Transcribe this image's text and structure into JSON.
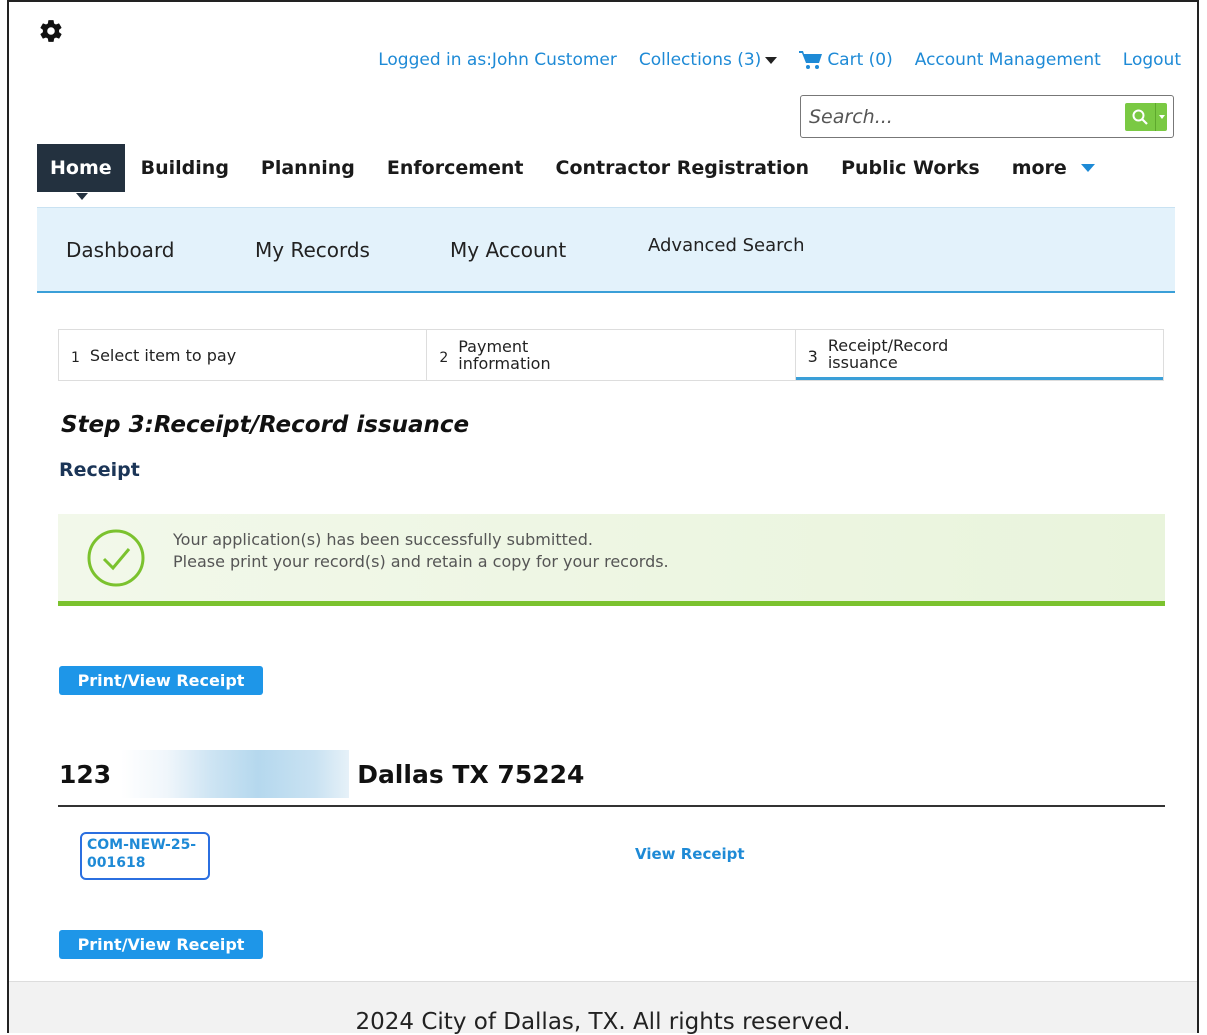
{
  "header": {
    "logged_in": "Logged in as:John Customer",
    "collections": "Collections (3)",
    "cart": "Cart (0)",
    "account_management": "Account Management",
    "logout": "Logout"
  },
  "search": {
    "placeholder": "Search..."
  },
  "main_nav": [
    "Home",
    "Building",
    "Planning",
    "Enforcement",
    "Contractor Registration",
    "Public Works",
    "more"
  ],
  "sub_nav": {
    "dashboard": "Dashboard",
    "my_records": "My Records",
    "my_account": "My Account",
    "advanced_search": "Advanced Search"
  },
  "steps": [
    {
      "num": "1",
      "label": "Select item to pay"
    },
    {
      "num": "2",
      "label": "Payment information"
    },
    {
      "num": "3",
      "label": "Receipt/Record issuance"
    }
  ],
  "page": {
    "step_title": "Step 3:Receipt/Record issuance",
    "section_title": "Receipt",
    "success_line1": "Your application(s) has been successfully submitted.",
    "success_line2": "Please print your record(s) and retain a copy for your records.",
    "print_button": "Print/View Receipt",
    "address_prefix": "123",
    "address_suffix": "Dallas TX 75224",
    "record_id": "COM-NEW-25-001618",
    "view_receipt": "View Receipt"
  },
  "footer": {
    "text": "2024 City of Dallas, TX. All rights reserved."
  },
  "colors": {
    "link": "#1e8ad6",
    "nav_active": "#23313f",
    "success": "#7bc22e",
    "button": "#1e96e8"
  }
}
